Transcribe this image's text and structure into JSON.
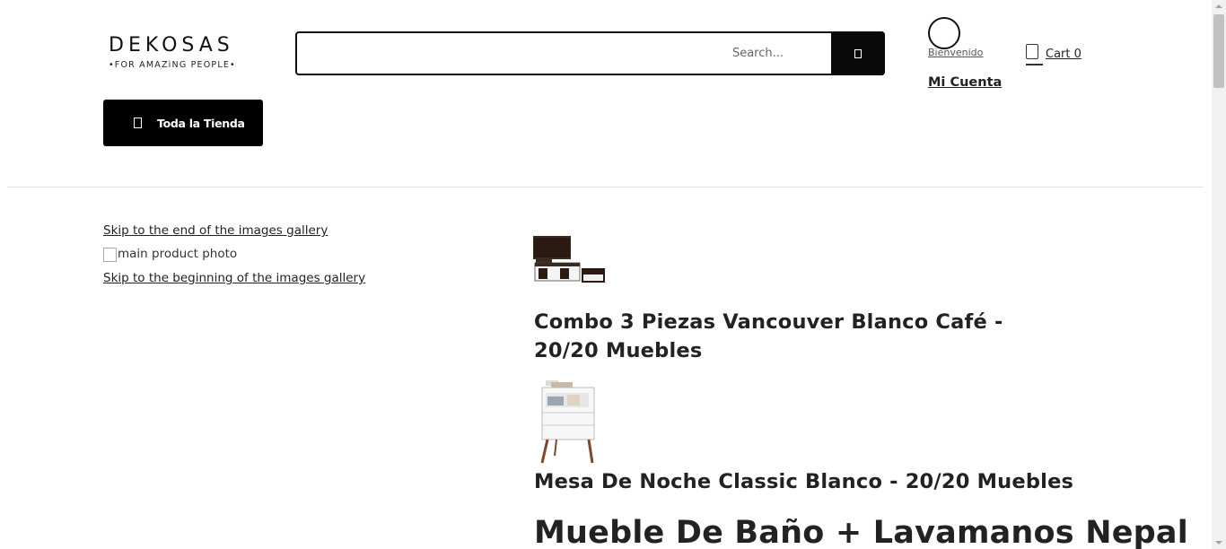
{
  "header": {
    "logo": {
      "name": "DEKOSAS",
      "tagline": "•FOR AMAZiNG PEOPLE•"
    },
    "search": {
      "placeholder": "Search...",
      "button_icon": "search-icon"
    },
    "account": {
      "welcome": "Bienvenido",
      "my_account": "Mi Cuenta",
      "avatar_icon": "user-icon"
    },
    "cart": {
      "label": "Cart 0",
      "icon": "cart-icon"
    },
    "store_button": {
      "label": "Toda la Tienda",
      "icon": "menu-icon"
    }
  },
  "gallery": {
    "skip_end": "Skip to the end of the images gallery",
    "photo_alt": "main product photo",
    "skip_start": "Skip to the beginning of the images gallery"
  },
  "products": [
    {
      "title": "Combo 3 Piezas Vancouver Blanco Café - 20/20 Muebles"
    },
    {
      "title": "Mesa De Noche Classic Blanco - 20/20 Muebles"
    },
    {
      "title": "Mueble De Baño + Lavamanos Nepal"
    }
  ],
  "colors": {
    "primary": "#000000",
    "text": "#222222",
    "divider": "#e3e3e3"
  }
}
